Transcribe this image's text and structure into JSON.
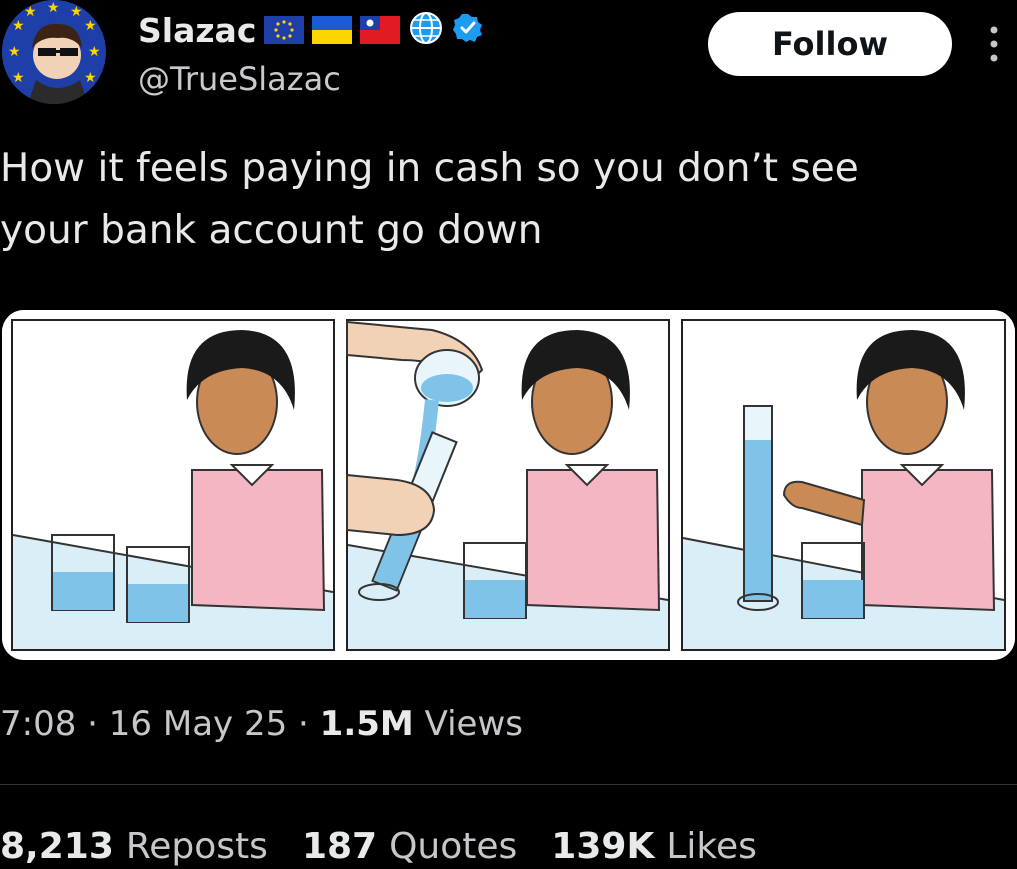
{
  "author": {
    "name": "Slazac",
    "handle": "@TrueSlazac",
    "badges": [
      "eu-flag-icon",
      "ukraine-flag-icon",
      "taiwan-flag-icon",
      "globe-icon",
      "verified-badge-icon"
    ]
  },
  "follow_label": "Follow",
  "tweet_text": "How it feels paying in cash so you don’t see\nyour bank account go down",
  "meta": {
    "time": "7:08",
    "date": "16 May 25",
    "views_count": "1.5M",
    "views_label": "Views"
  },
  "stats": {
    "reposts_count": "8,213",
    "reposts_label": "Reposts",
    "quotes_count": "187",
    "quotes_label": "Quotes",
    "likes_count": "139K",
    "likes_label": "Likes"
  },
  "colors": {
    "background": "#000000",
    "text": "#e7e9ea",
    "muted": "#c5c7ca",
    "verified": "#1d9bf0",
    "water": "#7fc4e8",
    "shirt": "#f4b6c2"
  }
}
